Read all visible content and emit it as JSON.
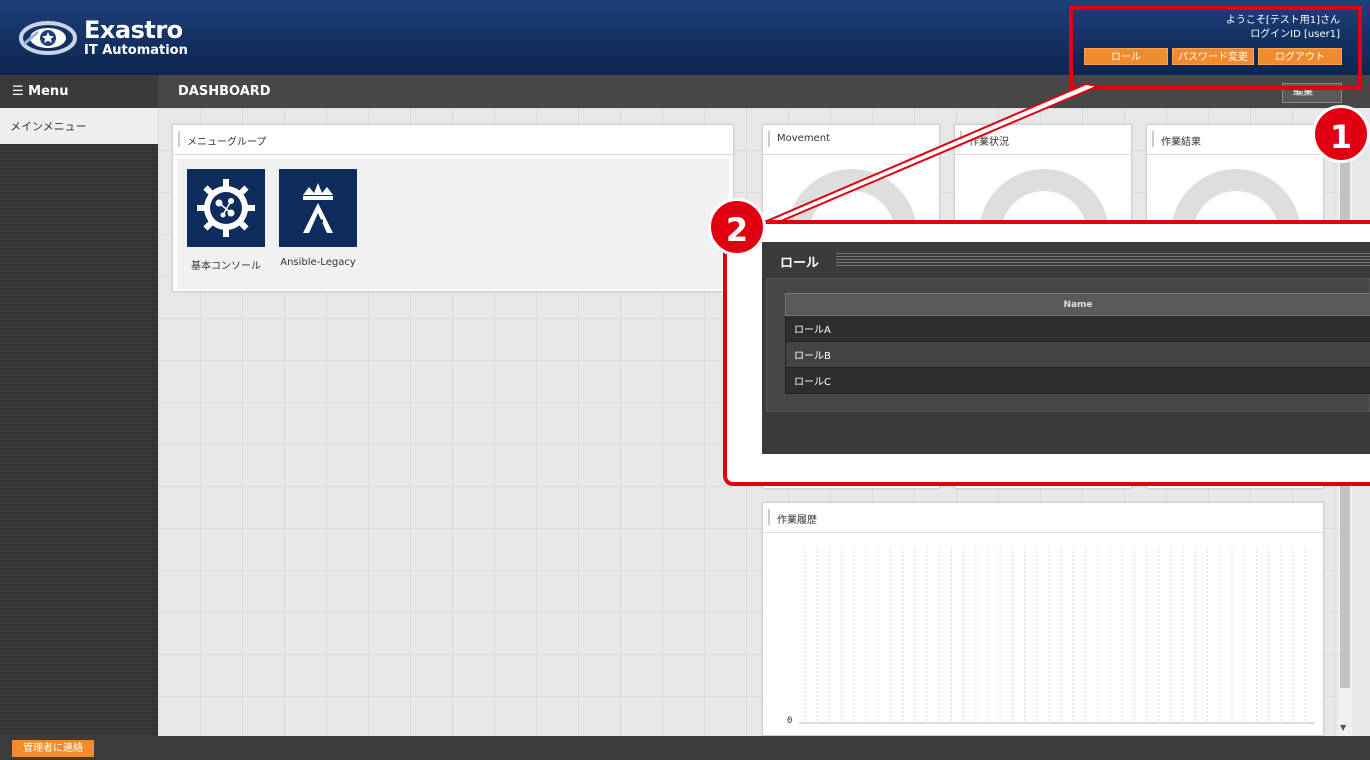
{
  "header": {
    "logo_title": "Exastro",
    "logo_subtitle": "IT Automation",
    "welcome": "ようこそ[テスト用1]さん",
    "login_id": "ログインID [user1]",
    "role_button": "ロール",
    "password_button": "パスワード変更",
    "logout_button": "ログアウト"
  },
  "menubar": {
    "menu_label": "☰ Menu",
    "page_title": "DASHBOARD",
    "edit_button": "編集"
  },
  "sidebar": {
    "items": [
      {
        "label": "メインメニュー"
      }
    ]
  },
  "panels": {
    "menugroup": {
      "title": "メニューグループ",
      "tiles": [
        {
          "label": "基本コンソール",
          "icon": "gear-network-icon"
        },
        {
          "label": "Ansible-Legacy",
          "icon": "ansible-crown-icon"
        }
      ]
    },
    "movement": {
      "title": "Movement"
    },
    "status": {
      "title": "作業状況"
    },
    "result": {
      "title": "作業結果"
    },
    "history": {
      "title": "作業履歴",
      "y_zero": "0"
    }
  },
  "footer": {
    "contact_button": "管理者に連絡"
  },
  "annotations": {
    "badge1": "1",
    "badge2": "2"
  },
  "role_popup": {
    "title": "ロール",
    "column_header": "Name",
    "rows": [
      "ロールA",
      "ロールB",
      "ロールC"
    ]
  },
  "colors": {
    "accent_orange": "#f08c2e",
    "header_navy": "#12305f",
    "callout_red": "#e00012"
  }
}
